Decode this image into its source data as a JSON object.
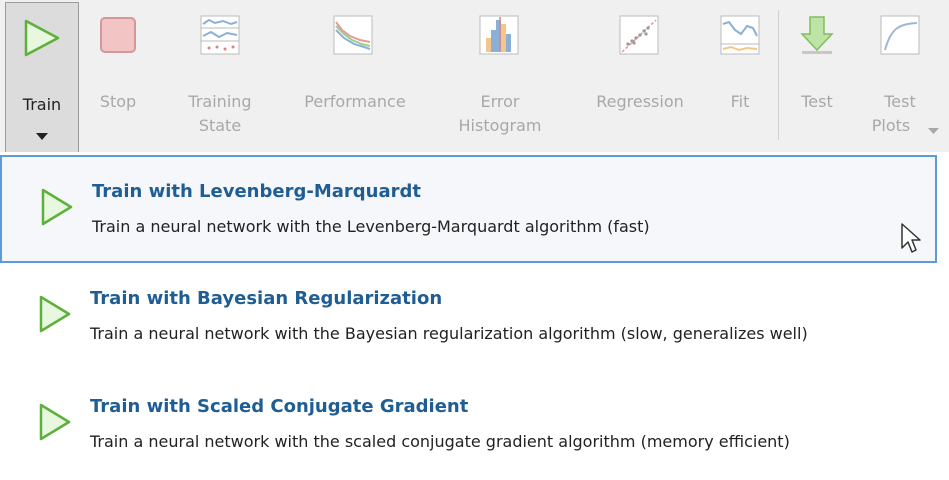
{
  "toolstrip": {
    "train": {
      "label": "Train"
    },
    "stop": {
      "label": "Stop"
    },
    "training_state": {
      "line1": "Training",
      "line2": "State"
    },
    "performance": {
      "label": "Performance"
    },
    "error_histogram": {
      "line1": "Error",
      "line2": "Histogram"
    },
    "regression": {
      "label": "Regression"
    },
    "fit": {
      "label": "Fit"
    },
    "test": {
      "label": "Test"
    },
    "test_plots": {
      "line1": "Test",
      "line2": "Plots"
    }
  },
  "menu": {
    "items": [
      {
        "title": "Train with Levenberg-Marquardt",
        "description": "Train a neural network with the Levenberg-Marquardt algorithm (fast)"
      },
      {
        "title": "Train with Bayesian Regularization",
        "description": "Train a neural network with the Bayesian regularization algorithm (slow, generalizes well)"
      },
      {
        "title": "Train with Scaled Conjugate Gradient",
        "description": "Train a neural network with the scaled conjugate gradient algorithm (memory efficient)"
      }
    ]
  },
  "colors": {
    "toolstrip_bg": "#f0f0f0",
    "accent_green": "#6cc04a",
    "title_blue": "#1f5d93",
    "selection_border": "#5a9bd8"
  }
}
